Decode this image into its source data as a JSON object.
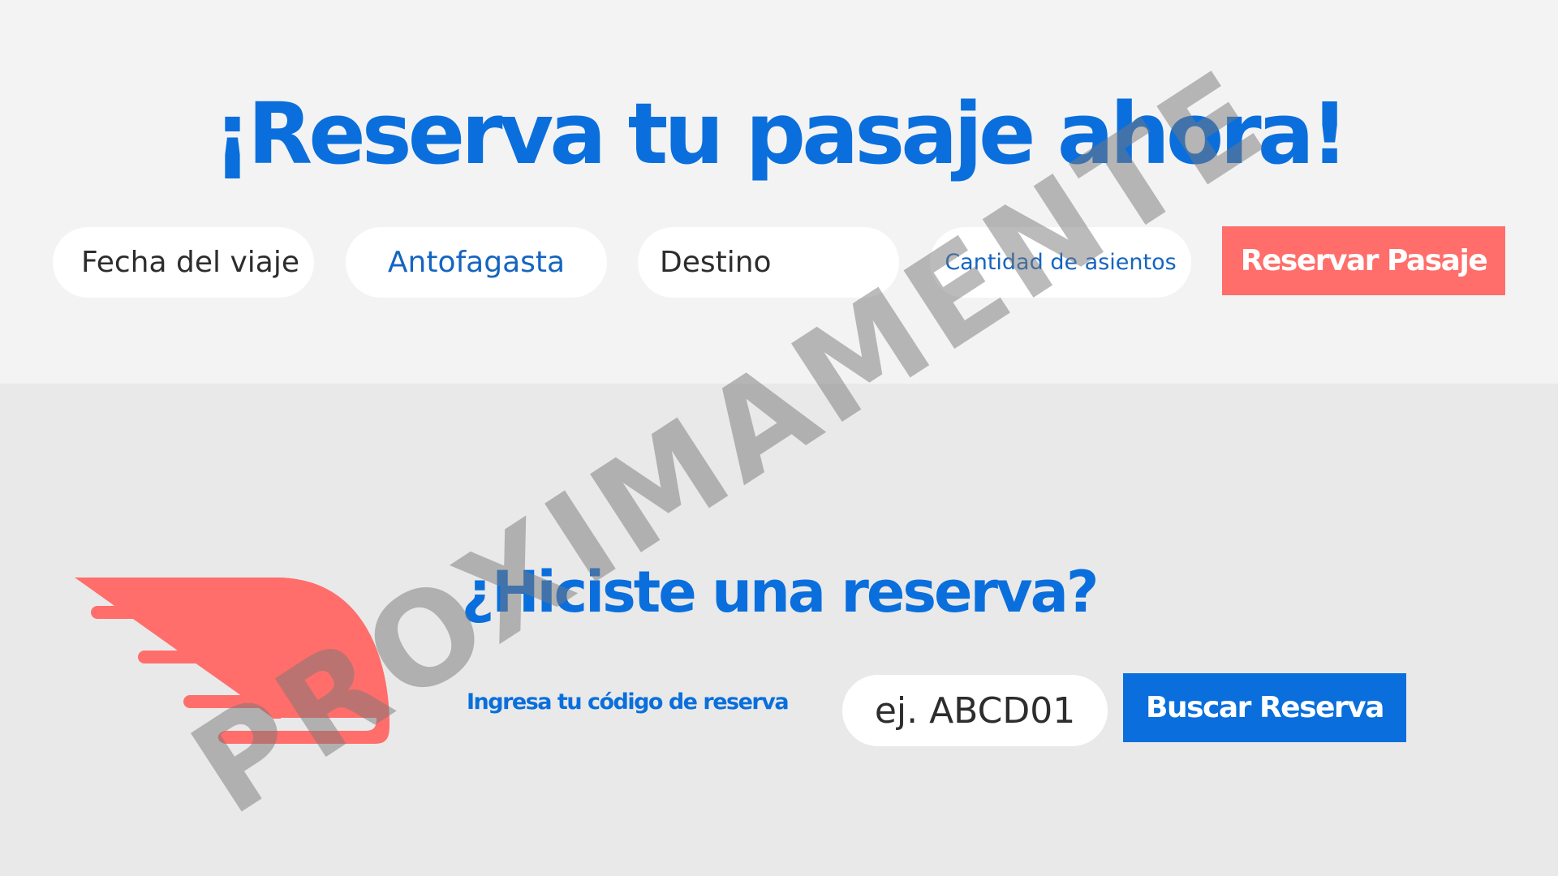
{
  "booking": {
    "title": "¡Reserva tu pasaje ahora!",
    "fields": {
      "date": "Fecha del viaje",
      "origin": "Antofagasta",
      "destination": "Destino",
      "seats": "Cantidad de asientos"
    },
    "submit_label": "Reservar Pasaje"
  },
  "lookup": {
    "title": "¿Hiciste una reserva?",
    "label": "Ingresa tu código de reserva",
    "placeholder": "ej. ABCD01",
    "submit_label": "Buscar Reserva"
  },
  "watermark": "PROXIMAMENTE",
  "colors": {
    "primary_blue": "#0a6fdc",
    "accent_coral": "#ff6e6b",
    "top_background": "#f3f3f3",
    "bottom_background": "#e9e9e9"
  },
  "icons": {
    "logo": "fast-bus-logo-icon"
  }
}
